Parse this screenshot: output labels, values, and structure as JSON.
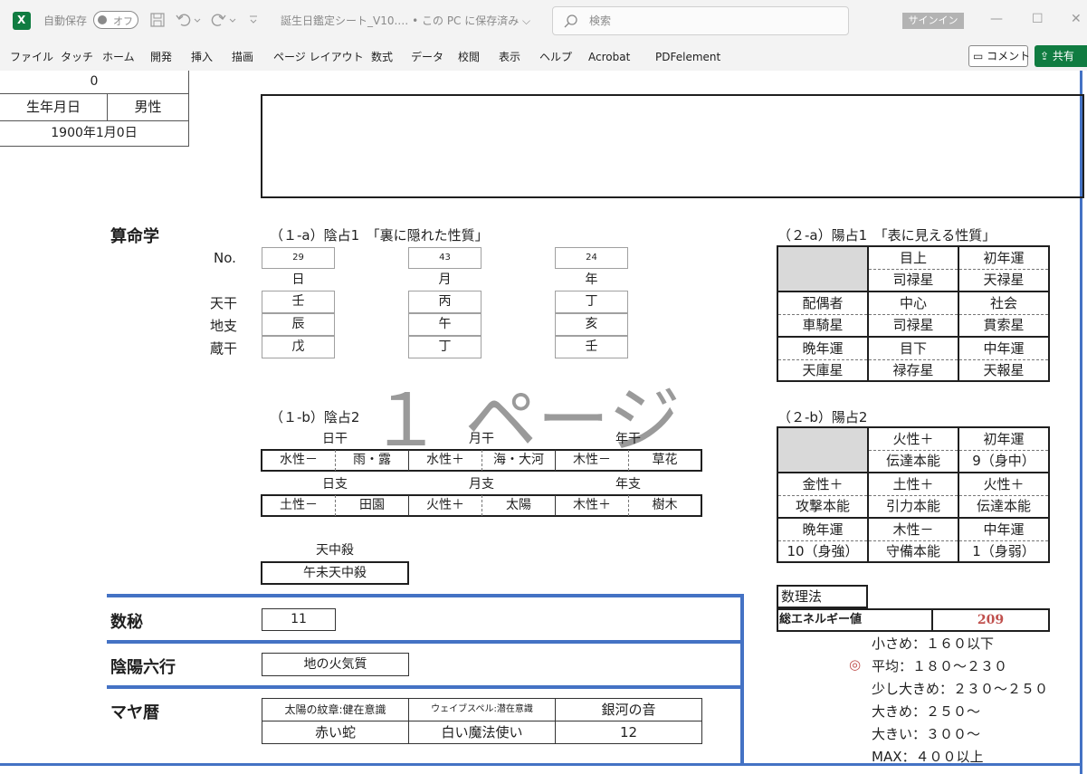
{
  "titlebar": {
    "autosave_label": "自動保存",
    "toggle_label": "オフ",
    "filename": "誕生日鑑定シート_V10.…  • この PC に保存済み ⌵",
    "search_placeholder": "検索",
    "signin": "サインイン",
    "minimize": "—",
    "restore": "☐",
    "close": "✕"
  },
  "ribbon": {
    "tabs": [
      "ファイル",
      "タッチ",
      "ホーム",
      "開発",
      "挿入",
      "描画",
      "ページ レイアウト",
      "数式",
      "データ",
      "校閲",
      "表示",
      "ヘルプ",
      "Acrobat",
      "PDFelement"
    ],
    "comment": "コメント",
    "share": "共有"
  },
  "header": {
    "top_value": "0",
    "birthdate_label": "生年月日",
    "gender": "男性",
    "birthdate": "1900年1月0日"
  },
  "sanmei": {
    "title": "算命学",
    "yin1_title": "（１-a）陰占1　「裏に隠れた性質」",
    "no_label": "No.",
    "nos": [
      "29",
      "43",
      "24"
    ],
    "col_headers": [
      "日",
      "月",
      "年"
    ],
    "row_labels": [
      "天干",
      "地支",
      "蔵干"
    ],
    "tenkan": [
      "壬",
      "丙",
      "丁"
    ],
    "chishi": [
      "辰",
      "午",
      "亥"
    ],
    "zoukan": [
      "戊",
      "丁",
      "壬"
    ],
    "yin2_title": "（１-b）陰占2",
    "kan_headers": [
      "日干",
      "月干",
      "年干"
    ],
    "kan_row": [
      "水性－",
      "雨・露",
      "水性＋",
      "海・大河",
      "木性－",
      "草花"
    ],
    "shi_headers": [
      "日支",
      "月支",
      "年支"
    ],
    "shi_row": [
      "土性－",
      "田園",
      "火性＋",
      "太陽",
      "木性＋",
      "樹木"
    ],
    "tenchusatsu_label": "天中殺",
    "tenchusatsu": "午未天中殺",
    "watermark": "１ ページ"
  },
  "yang1": {
    "title": "（２-a）陽占1　「表に見える性質」",
    "rows": [
      [
        "",
        "目上",
        "初年運"
      ],
      [
        "",
        "司禄星",
        "天禄星"
      ],
      [
        "配偶者",
        "中心",
        "社会"
      ],
      [
        "車騎星",
        "司禄星",
        "貫索星"
      ],
      [
        "晩年運",
        "目下",
        "中年運"
      ],
      [
        "天庫星",
        "禄存星",
        "天報星"
      ]
    ]
  },
  "yang2": {
    "title": "（２-b）陽占2",
    "rows": [
      [
        "",
        "火性＋",
        "初年運"
      ],
      [
        "",
        "伝達本能",
        "9（身中）"
      ],
      [
        "金性＋",
        "土性＋",
        "火性＋"
      ],
      [
        "攻撃本能",
        "引力本能",
        "伝達本能"
      ],
      [
        "晩年運",
        "木性－",
        "中年運"
      ],
      [
        "10（身強）",
        "守備本能",
        "1（身弱）"
      ]
    ]
  },
  "suri": {
    "title": "数理法",
    "energy_label": "総エネルギー値",
    "energy_value": "209",
    "ranges": [
      "小さめ：１６０以下",
      "平均：１８０～２３０",
      "少し大きめ：２３０～２５０",
      "大きめ：２５０～",
      "大きい：３００～",
      "MAX：４００以上"
    ],
    "marker": "◎"
  },
  "suhi": {
    "title": "数秘",
    "value": "11"
  },
  "inyou": {
    "title": "陰陽六行",
    "value": "地の火気質"
  },
  "maya": {
    "title": "マヤ暦",
    "headers": [
      "太陽の紋章:健在意識",
      "ウェイブスペル:潜在意識",
      "銀河の音"
    ],
    "values": [
      "赤い蛇",
      "白い魔法使い",
      "12"
    ]
  },
  "colors": {
    "excel_green": "#107c41",
    "blue_rule": "#4472c4",
    "energy_red": "#c0504d"
  }
}
